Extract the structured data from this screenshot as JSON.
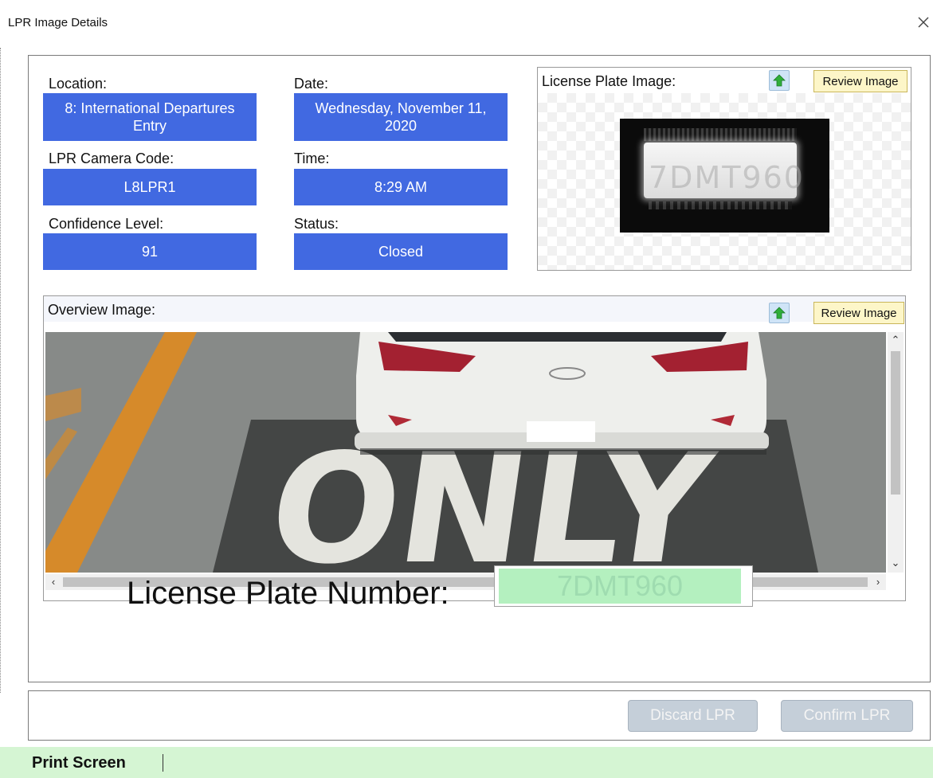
{
  "window": {
    "title": "LPR Image Details"
  },
  "details": {
    "location_label": "Location:",
    "location_value": "8: International Departures Entry",
    "date_label": "Date:",
    "date_value": "Wednesday, November 11, 2020",
    "camera_label": "LPR Camera Code:",
    "camera_value": "L8LPR1",
    "time_label": "Time:",
    "time_value": "8:29 AM",
    "confidence_label": "Confidence Level:",
    "confidence_value": "91",
    "status_label": "Status:",
    "status_value": "Closed"
  },
  "license_plate_image": {
    "label": "License Plate Image:",
    "review_button": "Review Image",
    "upload_icon": "green-up-arrow-icon",
    "plate_chars": "7DMT960"
  },
  "overview_image": {
    "label": "Overview Image:",
    "review_button": "Review Image",
    "upload_icon": "green-up-arrow-icon",
    "road_text": "ONLY"
  },
  "plate_number": {
    "label": "License Plate Number:",
    "value": "7DMT960"
  },
  "actions": {
    "discard": "Discard LPR",
    "confirm": "Confirm LPR"
  },
  "status_bar": {
    "item": "Print Screen"
  },
  "colors": {
    "field_bg": "#4169e1",
    "plate_input_bg": "#b4f0bf",
    "status_bar_bg": "#d5f5d3",
    "review_btn_bg": "#fdf6c8",
    "disabled_btn_bg": "#c5cfd9"
  }
}
